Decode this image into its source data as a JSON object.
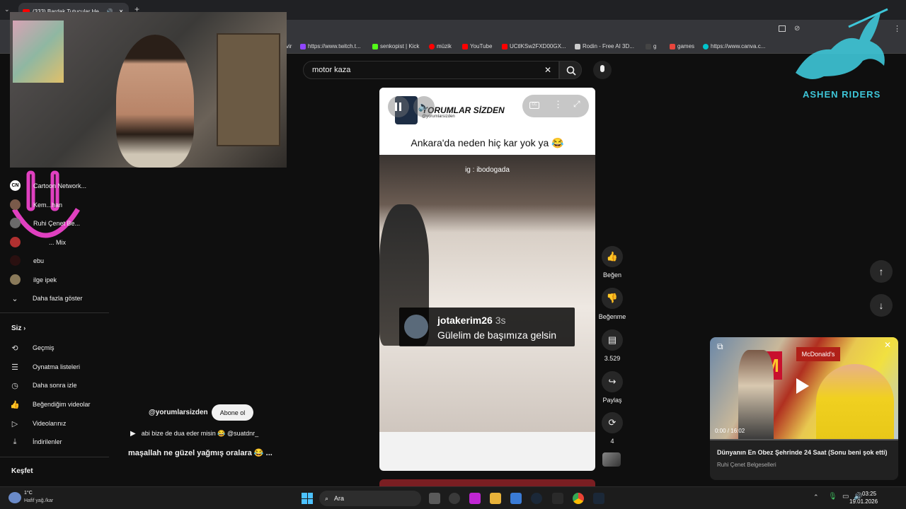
{
  "browser": {
    "tab_title": "(333) Bardak Tutucular He",
    "tab_close": "✕",
    "new_tab": "+",
    "bookmarks": [
      {
        "label": "vir",
        "color": "#888888"
      },
      {
        "label": "https://www.twitch.t...",
        "color": "#9146ff"
      },
      {
        "label": "senkopist | Kick",
        "color": "#53fc18"
      },
      {
        "label": "müzik",
        "color": "#ff0000"
      },
      {
        "label": "YouTube",
        "color": "#ff0000"
      },
      {
        "label": "UCtlKSw2FXD00GX...",
        "color": "#ff0000"
      },
      {
        "label": "Rodin - Free AI 3D...",
        "color": "#cccccc"
      },
      {
        "label": "g",
        "color": "#222222"
      },
      {
        "label": "games",
        "color": "#e8453c"
      },
      {
        "label": "https://www.canva.c...",
        "color": "#00c4cc"
      }
    ]
  },
  "search": {
    "query": "motor kaza",
    "clear": "✕"
  },
  "sidebar": {
    "subscriptions": [
      {
        "label": "Cartoon Network..."
      },
      {
        "label": "Kem...han"
      },
      {
        "label": "Ruhi Çenet Be..."
      },
      {
        "label": "... Mix"
      },
      {
        "label": "ebu"
      },
      {
        "label": "ilge ipek"
      }
    ],
    "show_more": "Daha fazla göster",
    "you_title": "Siz",
    "you_items": [
      {
        "label": "Geçmiş",
        "icon": "history-icon",
        "glyph": "⟲"
      },
      {
        "label": "Oynatma listeleri",
        "icon": "playlists-icon",
        "glyph": "☰"
      },
      {
        "label": "Daha sonra izle",
        "icon": "watch-later-icon",
        "glyph": "◷"
      },
      {
        "label": "Beğendiğim videolar",
        "icon": "liked-icon",
        "glyph": "👍"
      },
      {
        "label": "Videolarınız",
        "icon": "your-videos-icon",
        "glyph": "▷"
      },
      {
        "label": "İndirilenler",
        "icon": "downloads-icon",
        "glyph": "⤓"
      }
    ],
    "explore_title": "Keşfet"
  },
  "short": {
    "channel_banner": "YORUMLAR SİZDEN",
    "channel_handle_small": "@yorumlarsizden",
    "caption": "Ankara'da neden hiç kar yok ya 😂",
    "watermark": "ig : ibodogada",
    "comment_user": "jotakerim26",
    "comment_time": "3s",
    "comment_text": "Gülelim de başımıza gelsin",
    "channel_handle": "@yorumlarsizden",
    "subscribe_label": "Abone ol",
    "title_line": "abi bize de dua eder misin 😂 @suatdnr_",
    "comment_line": "maşallah ne güzel yağmış oralara 😂 ..."
  },
  "actions": {
    "like": "Beğen",
    "dislike": "Beğenme",
    "comments": "3.529",
    "share": "Paylaş",
    "remix": "4"
  },
  "miniplayer": {
    "time": "0:00 / 16:02",
    "title": "Dünyanın En Obez Şehrinde 24 Saat (Sonu beni şok etti)",
    "channel": "Ruhi Çenet Belgeselleri",
    "sign": "McDonald's"
  },
  "overlay": {
    "logo_text": "ASHEN RIDERS"
  },
  "taskbar": {
    "weather_temp": "1°C",
    "weather_desc": "Hafif yağ./kar",
    "search_label": "Ara",
    "time": "03:25",
    "date": "19.01.2026"
  },
  "colors": {
    "accent": "#ff0000",
    "subscribe_bg": "#f1f1f1",
    "logo": "#3ec6d8"
  }
}
